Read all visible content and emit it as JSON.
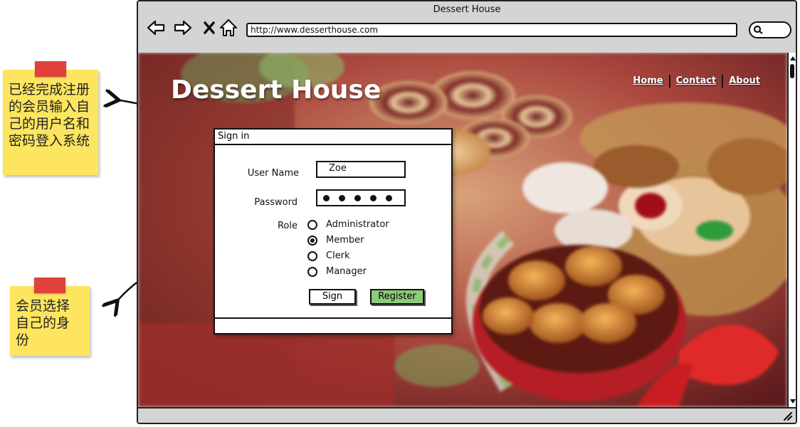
{
  "browser": {
    "title": "Dessert House",
    "url": "http://www.desserthouse.com",
    "icons": [
      "back-arrow-icon",
      "forward-arrow-icon",
      "close-icon",
      "home-icon",
      "search-icon",
      "resize-grip-icon"
    ]
  },
  "site": {
    "title": "Dessert House",
    "nav": [
      "Home",
      "Contact",
      "About"
    ]
  },
  "dialog": {
    "title": "Sign in",
    "username_label": "User Name",
    "username_value": "Zoe",
    "password_label": "Password",
    "password_mask_count": 5,
    "role_label": "Role",
    "roles": [
      {
        "label": "Administrator",
        "selected": false
      },
      {
        "label": "Member",
        "selected": true
      },
      {
        "label": "Clerk",
        "selected": false
      },
      {
        "label": "Manager",
        "selected": false
      }
    ],
    "sign_button": "Sign",
    "register_button": "Register"
  },
  "notes": {
    "note1": "已经完成注册的会员输入自己的用户名和密码登入系统",
    "note2": "会员选择自己的身份"
  },
  "colors": {
    "note_yellow": "#fde560",
    "tape_red": "#e0413a",
    "register_green": "#8ccc78",
    "frame_gray": "#d4d4d4"
  }
}
